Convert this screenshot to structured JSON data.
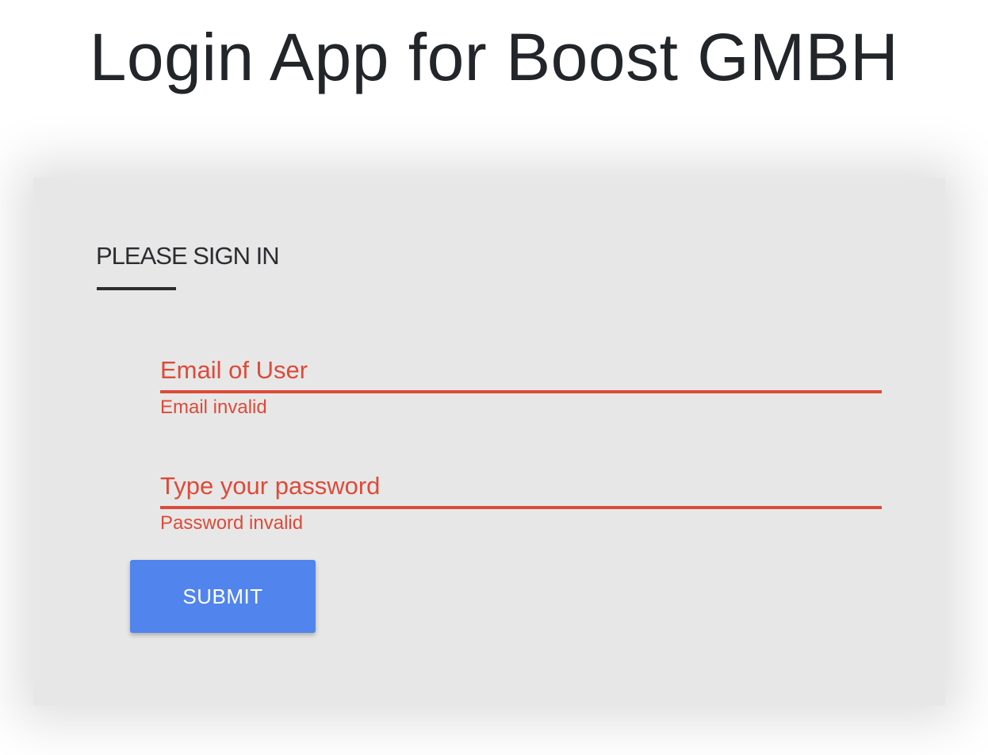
{
  "header": {
    "title": "Login App for Boost GMBH"
  },
  "login_card": {
    "heading": "PLEASE SIGN IN",
    "email": {
      "placeholder": "Email of User",
      "value": "",
      "error": "Email invalid"
    },
    "password": {
      "placeholder": "Type your password",
      "value": "",
      "error": "Password invalid"
    },
    "submit_label": "SUBMIT"
  },
  "colors": {
    "error": "#dc4b39",
    "primary_button": "#5184ec",
    "card_background": "#e7e7e7",
    "text": "#222529"
  }
}
